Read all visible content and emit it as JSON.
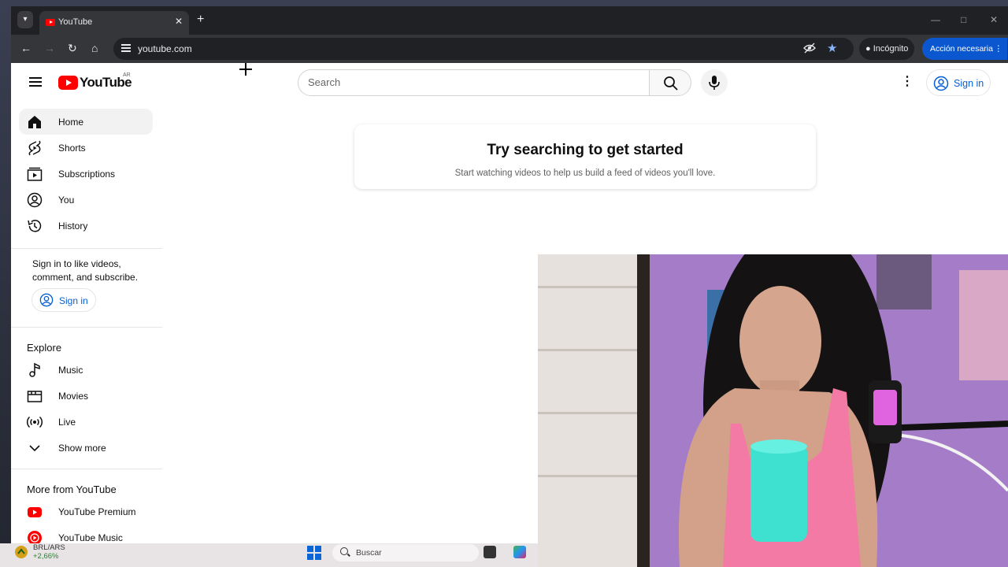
{
  "browser": {
    "tab_title": "YouTube",
    "url": "youtube.com",
    "incognito_label": "Incógnito",
    "action_label": "Acción necesaria"
  },
  "youtube": {
    "logo_text": "YouTube",
    "region": "AR",
    "search_placeholder": "Search",
    "signin_label": "Sign in",
    "sidebar": {
      "main": [
        {
          "label": "Home",
          "icon": "home-icon",
          "active": true
        },
        {
          "label": "Shorts",
          "icon": "shorts-icon"
        },
        {
          "label": "Subscriptions",
          "icon": "subscriptions-icon"
        },
        {
          "label": "You",
          "icon": "you-icon"
        },
        {
          "label": "History",
          "icon": "history-icon"
        }
      ],
      "signin_message": "Sign in to like videos, comment, and subscribe.",
      "signin_button": "Sign in",
      "explore_title": "Explore",
      "explore": [
        {
          "label": "Music",
          "icon": "music-icon"
        },
        {
          "label": "Movies",
          "icon": "movies-icon"
        },
        {
          "label": "Live",
          "icon": "live-icon"
        },
        {
          "label": "Show more",
          "icon": "chevron-down-icon"
        }
      ],
      "more_title": "More from YouTube",
      "more": [
        {
          "label": "YouTube Premium",
          "icon": "youtube-premium-icon"
        },
        {
          "label": "YouTube Music",
          "icon": "youtube-music-icon"
        }
      ]
    },
    "empty_state": {
      "title": "Try searching to get started",
      "subtitle": "Start watching videos to help us build a feed of videos you'll love."
    }
  },
  "taskbar": {
    "ticker_name": "BRL/ARS",
    "ticker_change": "+2,66%",
    "search_placeholder": "Buscar"
  },
  "colors": {
    "brand_red": "#ff0000",
    "link_blue": "#065fd4",
    "chrome_dark": "#202124",
    "action_blue": "#0b57d0"
  }
}
